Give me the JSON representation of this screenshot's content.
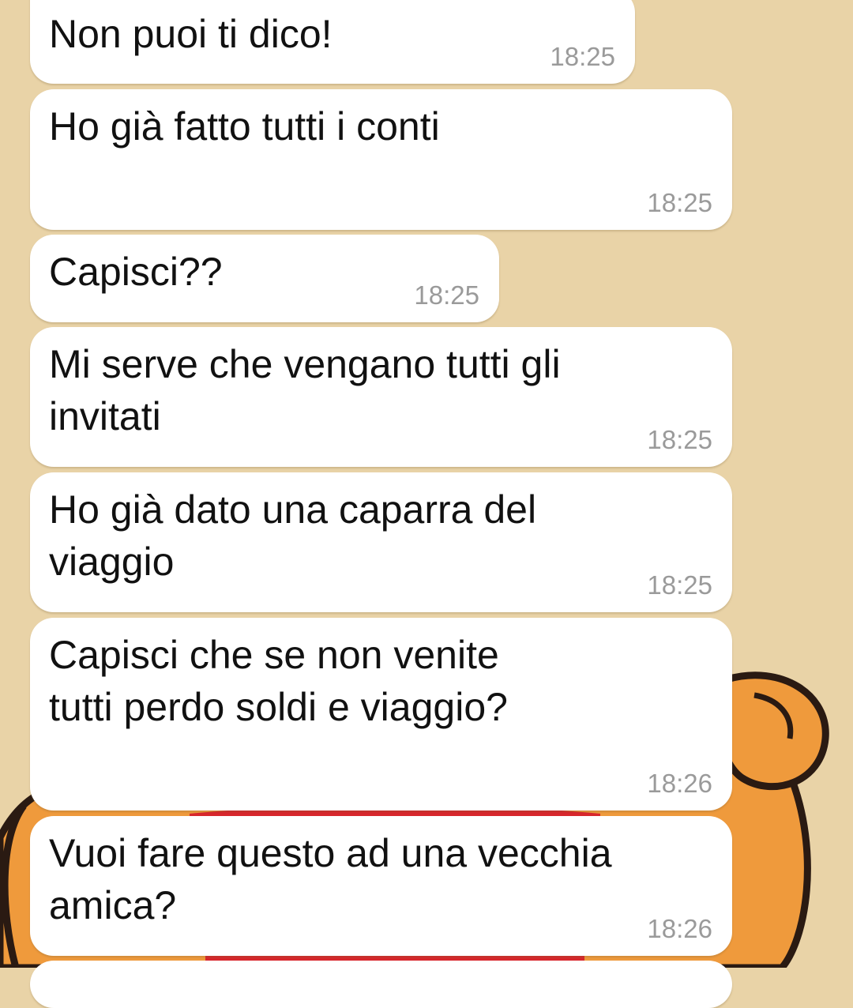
{
  "colors": {
    "wallpaper": "#e9d3a7",
    "bubble": "#ffffff",
    "message_text": "#111111",
    "timestamp": "#9a9a9a",
    "cartoon_fill": "#ef9a3c",
    "cartoon_outline": "#2a1a12"
  },
  "messages": [
    {
      "text": "Non puoi ti dico!",
      "time": "18:25"
    },
    {
      "text": "Ho già fatto tutti i conti",
      "time": "18:25"
    },
    {
      "text": "Capisci??",
      "time": "18:25"
    },
    {
      "text": "Mi serve che vengano tutti gli\ninvitati",
      "time": "18:25"
    },
    {
      "text": "Ho già dato una caparra del\nviaggio",
      "time": "18:25"
    },
    {
      "text": "Capisci che se non venite\ntutti perdo soldi e viaggio?",
      "time": "18:26"
    },
    {
      "text": "Vuoi fare questo ad una vecchia\namica?",
      "time": "18:26"
    }
  ]
}
